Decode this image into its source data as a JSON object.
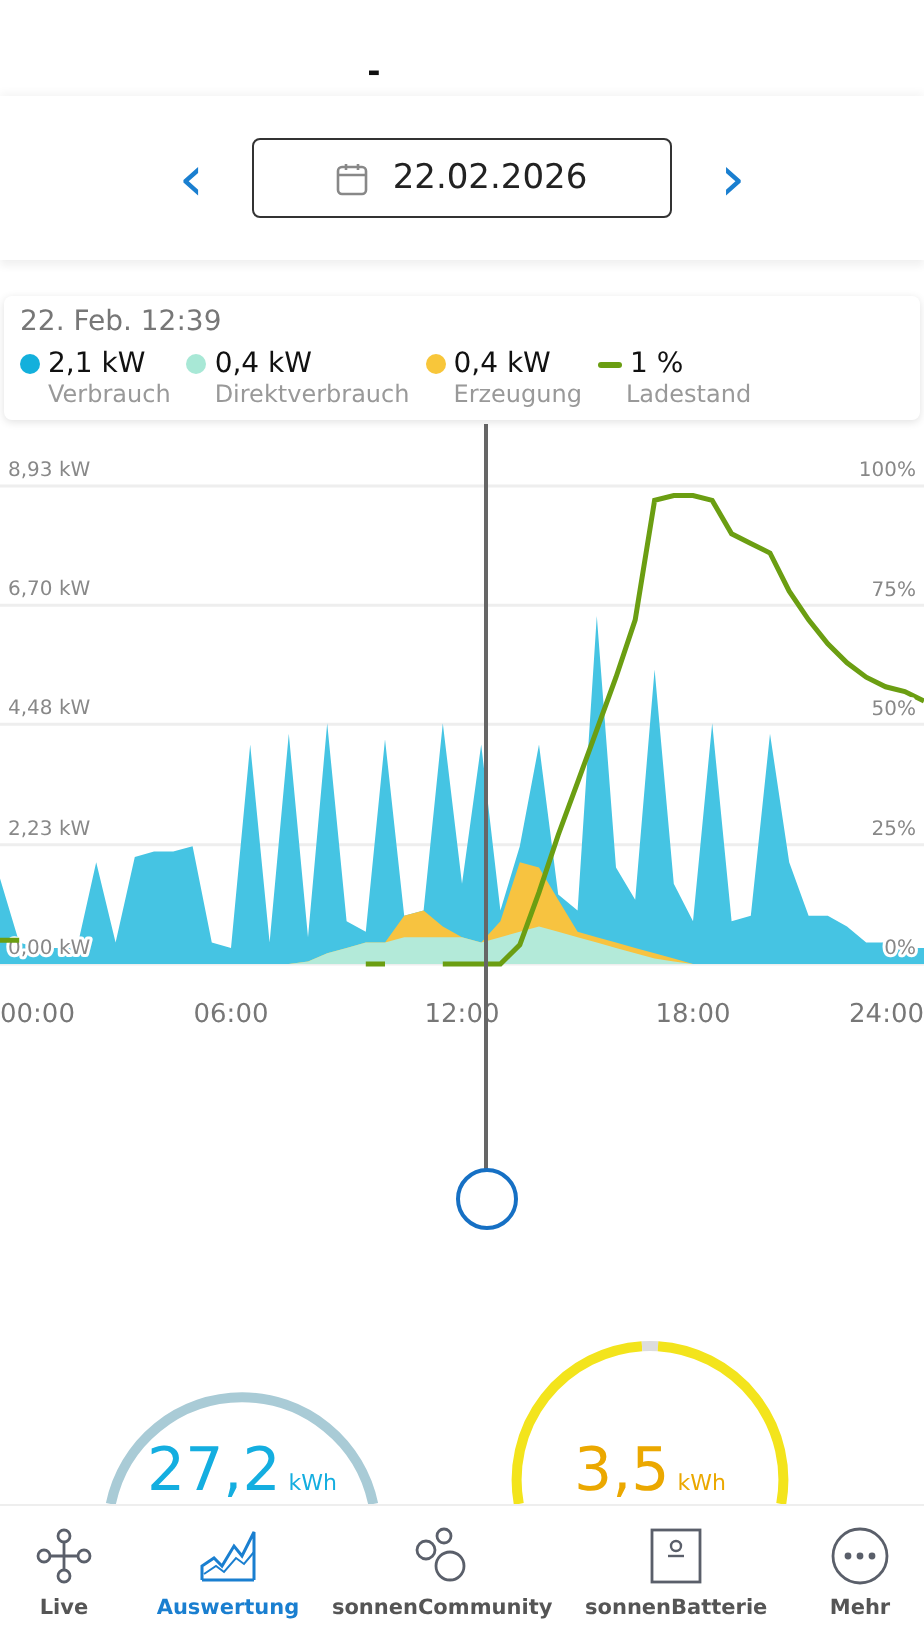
{
  "header": {
    "title": "-"
  },
  "date_picker": {
    "previous": "‹",
    "next": "›",
    "date": "22.02.2026"
  },
  "tooltip": {
    "time": "22. Feb. 12:39",
    "legend": [
      {
        "kind": "dot",
        "value": "2,1 kW",
        "label": "Verbrauch",
        "color": "#13b0dc"
      },
      {
        "kind": "dot",
        "value": "0,4 kW",
        "label": "Direktverbrauch",
        "color": "#a8e8d6"
      },
      {
        "kind": "dot",
        "value": "0,4 kW",
        "label": "Erzeugung",
        "color": "#f8c63a"
      },
      {
        "kind": "line",
        "value": "1 %",
        "label": "Ladestand",
        "color": "#6b9e12"
      }
    ]
  },
  "chart": {
    "chart_data": {
      "type": "area",
      "ylim": [
        0,
        8.93
      ],
      "xlim": [
        0,
        24
      ],
      "x": [
        0,
        0.5,
        1,
        1.5,
        2,
        2.5,
        3,
        3.5,
        4,
        4.5,
        5,
        5.5,
        6,
        6.5,
        7,
        7.5,
        8,
        8.5,
        9,
        9.5,
        10,
        10.5,
        11,
        11.5,
        12,
        12.5,
        13,
        13.5,
        14,
        14.5,
        15,
        15.5,
        16,
        16.5,
        17,
        17.5,
        18,
        18.5,
        19,
        19.5,
        20,
        20.5,
        21,
        21.5,
        22,
        22.5,
        23,
        23.5,
        24
      ],
      "xticks": [
        {
          "value": 0,
          "label": "00:00"
        },
        {
          "value": 6,
          "label": "06:00"
        },
        {
          "value": 12,
          "label": "12:00"
        },
        {
          "value": 18,
          "label": "18:00"
        },
        {
          "value": 24,
          "label": "24:00"
        }
      ],
      "yticks": [
        {
          "value": 0,
          "label": "0,00 kW"
        },
        {
          "value": 2.23,
          "label": "2,23 kW"
        },
        {
          "value": 4.48,
          "label": "4,48 kW"
        },
        {
          "value": 6.7,
          "label": "6,70 kW"
        },
        {
          "value": 8.93,
          "label": "8,93 kW"
        }
      ],
      "series": [
        {
          "color": "#45c4e3",
          "values": [
            1.6,
            0.4,
            0.3,
            0.3,
            0.3,
            1.9,
            0.4,
            2.0,
            2.1,
            2.1,
            2.2,
            0.4,
            0.3,
            4.1,
            0.4,
            4.3,
            0.5,
            4.5,
            0.8,
            0.6,
            4.2,
            0.9,
            1.0,
            4.5,
            1.5,
            4.1,
            1.0,
            2.2,
            4.1,
            1.3,
            1.0,
            6.5,
            1.8,
            1.2,
            5.5,
            1.5,
            0.8,
            4.5,
            0.8,
            0.9,
            4.3,
            1.9,
            0.9,
            0.9,
            0.7,
            0.4,
            0.4,
            0.3,
            0.3
          ]
        },
        {
          "color": "#f7c340",
          "values": [
            0,
            0,
            0,
            0,
            0,
            0,
            0,
            0,
            0,
            0,
            0,
            0,
            0,
            0,
            0,
            0,
            0.05,
            0.2,
            0.3,
            0.4,
            0.4,
            0.9,
            1.0,
            0.7,
            0.5,
            0.4,
            0.8,
            1.9,
            1.8,
            1.2,
            0.6,
            0.5,
            0.4,
            0.3,
            0.2,
            0.1,
            0,
            0,
            0,
            0,
            0,
            0,
            0,
            0,
            0,
            0,
            0,
            0,
            0
          ]
        },
        {
          "color": "#b3ead9",
          "values": [
            0,
            0,
            0,
            0,
            0,
            0,
            0,
            0,
            0,
            0,
            0,
            0,
            0,
            0,
            0,
            0,
            0.05,
            0.2,
            0.3,
            0.4,
            0.4,
            0.5,
            0.5,
            0.5,
            0.5,
            0.4,
            0.5,
            0.6,
            0.7,
            0.6,
            0.5,
            0.4,
            0.3,
            0.2,
            0.1,
            0.05,
            0,
            0,
            0,
            0,
            0,
            0,
            0,
            0,
            0,
            0,
            0,
            0,
            0
          ]
        }
      ],
      "grid": true
    }
  },
  "soc_chart": {
    "chart_data": {
      "type": "line",
      "ylim": [
        0,
        100
      ],
      "xlim": [
        0,
        24
      ],
      "x": [
        0,
        0.5,
        1,
        1.5,
        2,
        2.5,
        3,
        3.5,
        4,
        4.5,
        5,
        5.5,
        6,
        6.5,
        7,
        7.5,
        8,
        8.5,
        9,
        9.5,
        10,
        10.5,
        11,
        11.5,
        12,
        12.5,
        13,
        13.5,
        14,
        14.5,
        15,
        15.5,
        16,
        16.5,
        17,
        17.5,
        18,
        18.5,
        19,
        19.5,
        20,
        20.5,
        21,
        21.5,
        22,
        22.5,
        23,
        23.5,
        24
      ],
      "yticks": [
        {
          "value": 0,
          "label": "0%"
        },
        {
          "value": 25,
          "label": "25%"
        },
        {
          "value": 50,
          "label": "50%"
        },
        {
          "value": 75,
          "label": "75%"
        },
        {
          "value": 100,
          "label": "100%"
        }
      ],
      "series": [
        {
          "color": "#6b9e12",
          "values": [
            5,
            5,
            null,
            null,
            null,
            null,
            null,
            null,
            null,
            null,
            null,
            null,
            null,
            null,
            null,
            null,
            null,
            null,
            null,
            0,
            0,
            null,
            null,
            0,
            0,
            0,
            0,
            4,
            15,
            27,
            38,
            49,
            60,
            72,
            97,
            98,
            98,
            97,
            90,
            88,
            86,
            78,
            72,
            67,
            63,
            60,
            58,
            57,
            55
          ]
        }
      ]
    }
  },
  "gauges": [
    {
      "kind": "consumption",
      "value": "27,2",
      "unit": "kWh",
      "color": "#14aee0"
    },
    {
      "kind": "production",
      "value": "3,5",
      "unit": "kWh",
      "color": "#eba800"
    }
  ],
  "tabs": [
    {
      "label": "Live",
      "selected": false
    },
    {
      "label": "Auswertung",
      "selected": true
    },
    {
      "label": "sonnenCommunity",
      "selected": false
    },
    {
      "label": "sonnenBatterie",
      "selected": false
    },
    {
      "label": "Mehr",
      "selected": false
    }
  ]
}
